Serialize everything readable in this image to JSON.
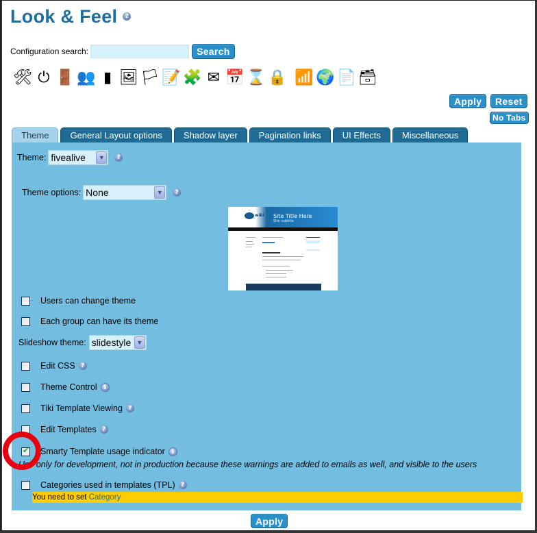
{
  "header": {
    "title": "Look & Feel",
    "help_icon": "help-icon"
  },
  "search": {
    "label": "Configuration search:",
    "value": "",
    "placeholder": "",
    "button": "Search"
  },
  "toolbar_icons": [
    {
      "name": "tools-icon",
      "glyph": "🛠"
    },
    {
      "name": "power-icon",
      "glyph": "⏻"
    },
    {
      "name": "login-door-icon",
      "glyph": "🚪"
    },
    {
      "name": "users-icon",
      "glyph": "👥"
    },
    {
      "name": "profile-silhouette-icon",
      "glyph": "▮"
    },
    {
      "name": "look-and-feel-icon",
      "glyph": "🖼"
    },
    {
      "name": "i18n-flag-icon",
      "glyph": "🏳"
    },
    {
      "name": "editing-notepad-icon",
      "glyph": "📝"
    },
    {
      "name": "modules-icon",
      "glyph": "🧩"
    },
    {
      "name": "messages-icon",
      "glyph": "✉"
    },
    {
      "name": "calendar-icon",
      "glyph": "📅"
    },
    {
      "name": "hourglass-icon",
      "glyph": "⌛"
    },
    {
      "name": "security-lock-icon",
      "glyph": "🔒"
    },
    {
      "name": "rss-icon",
      "glyph": "📶"
    },
    {
      "name": "webservices-globe-icon",
      "glyph": "🌍"
    },
    {
      "name": "wiki-icon",
      "glyph": "📄"
    },
    {
      "name": "file-cabinet-icon",
      "glyph": "🗃"
    }
  ],
  "actions": {
    "apply": "Apply",
    "reset": "Reset",
    "no_tabs": "No Tabs"
  },
  "tabs": [
    {
      "label": "Theme",
      "active": true
    },
    {
      "label": "General Layout options",
      "active": false
    },
    {
      "label": "Shadow layer",
      "active": false
    },
    {
      "label": "Pagination links",
      "active": false
    },
    {
      "label": "UI Effects",
      "active": false
    },
    {
      "label": "Miscellaneous",
      "active": false
    }
  ],
  "theme_tab": {
    "theme": {
      "label": "Theme:",
      "value": "fivealive"
    },
    "theme_options": {
      "label": "Theme options:",
      "value": "None"
    },
    "preview": {
      "site_title": "Site Title Here",
      "site_subtitle": "Site subtitle",
      "logo_text": "wiki"
    },
    "users_can_change_theme": {
      "label": "Users can change theme",
      "checked": false
    },
    "each_group_theme": {
      "label": "Each group can have its theme",
      "checked": false
    },
    "slideshow_theme": {
      "label": "Slideshow theme:",
      "value": "slidestyle"
    },
    "edit_css": {
      "label": "Edit CSS",
      "checked": false
    },
    "theme_control": {
      "label": "Theme Control",
      "checked": false
    },
    "tiki_template_viewing": {
      "label": "Tiki Template Viewing",
      "checked": false
    },
    "edit_templates": {
      "label": "Edit Templates",
      "checked": false
    },
    "smarty_indicator": {
      "label": "Smarty Template usage indicator",
      "checked": true,
      "note": "Use only for development, not in production because these warnings are added to emails as well, and visible to the users"
    },
    "categories_tpl": {
      "label": "Categories used in templates (TPL)",
      "checked": false
    },
    "warning": {
      "text": "You need to set ",
      "link": "Category"
    }
  },
  "colors": {
    "accent": "#2990c9",
    "title": "#1e6fa0",
    "panel": "#73bde1",
    "tab": "#1f6b93",
    "tab_active": "#a7d3ea",
    "warning": "#ffcc00",
    "highlight_ring": "#e8000f"
  }
}
